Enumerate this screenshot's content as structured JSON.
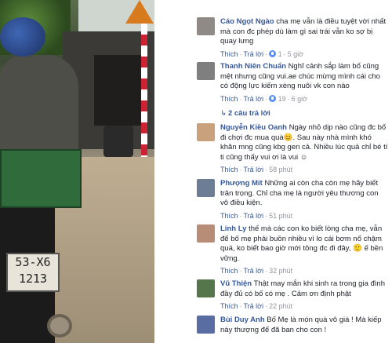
{
  "photo": {
    "plate_line1": "53-X6",
    "plate_line2": "1213"
  },
  "colors": {
    "link": "#365899",
    "meta": "#90949c",
    "text": "#1d2129",
    "like": "#5890ff"
  },
  "comments": [
    {
      "name": "Cáo Ngọt Ngào",
      "text": "cha mẹ vẫn là điều tuyệt vời nhất mà con đc phép dù làm gì sai trái vẫn ko sợ bị quay lưng",
      "actions": [
        "Thích",
        "Trả lời"
      ],
      "likes": "1",
      "time": "5 giờ",
      "avatar_color": "#8f8a86"
    },
    {
      "name": "Thanh Niên Chuẩn",
      "text": "Nghĩ cảnh sắp làm bố cũng mệt nhưng cũng vui.ae chúc mừng mình cái cho có động lực kiếm xèng nuôi vk con nào",
      "actions": [
        "Thích",
        "Trả lời"
      ],
      "likes": "19",
      "time": "6 giờ",
      "avatar_color": "#7f7f7f",
      "replies": "2 câu trả lời"
    },
    {
      "name": "Nguyễn Kiều Oanh",
      "text": "Ngày nhỏ dịp nào cũng đc bố đi chợi đc mua quà😊. Sau này nhà mình khó khăn mng cũng kbg gen cả. Nhiều lúc quả chỉ bé tí ti cũng thấy vui ơi là vui ☺",
      "actions": [
        "Thích",
        "Trả lời"
      ],
      "likes": "",
      "time": "58 phút",
      "avatar_color": "#c9a17d"
    },
    {
      "name": "Phượng Mít",
      "text": "Những ai còn cha còn mẹ hãy biết trân trọng. Chỉ cha mẹ là người yêu thương con vô điều kiện.",
      "actions": [
        "Thích",
        "Trả lời"
      ],
      "likes": "",
      "time": "51 phút",
      "avatar_color": "#6d7d96"
    },
    {
      "name": "Linh Ly",
      "text": "thế mà các con ko biết lòng cha mẹ, vẫn để bố mẹ phải buồn nhiều vì lo cái bơm nổ chậm quá, ko biết bao giờ mới tông đc đi đây, 🙂 ế bền vững.",
      "actions": [
        "Thích",
        "Trả lời"
      ],
      "likes": "",
      "time": "32 phút",
      "avatar_color": "#b78d78"
    },
    {
      "name": "Vũ Thiện",
      "text": "Thật may mắn khi sinh ra trong gia đình đầy đủ có bố có mẹ . Cảm ơn định phật",
      "actions": [
        "Thích",
        "Trả lời"
      ],
      "likes": "",
      "time": "22 phút",
      "avatar_color": "#55764a"
    },
    {
      "name": "Bùi Duy Anh",
      "text": "Bố Mẹ là món quà vô giá ! Mà kiếp này thượng để đã ban cho con !",
      "actions": [
        "Thích",
        "Trả lời"
      ],
      "likes": "",
      "time": "",
      "avatar_color": "#5a6da3"
    }
  ]
}
